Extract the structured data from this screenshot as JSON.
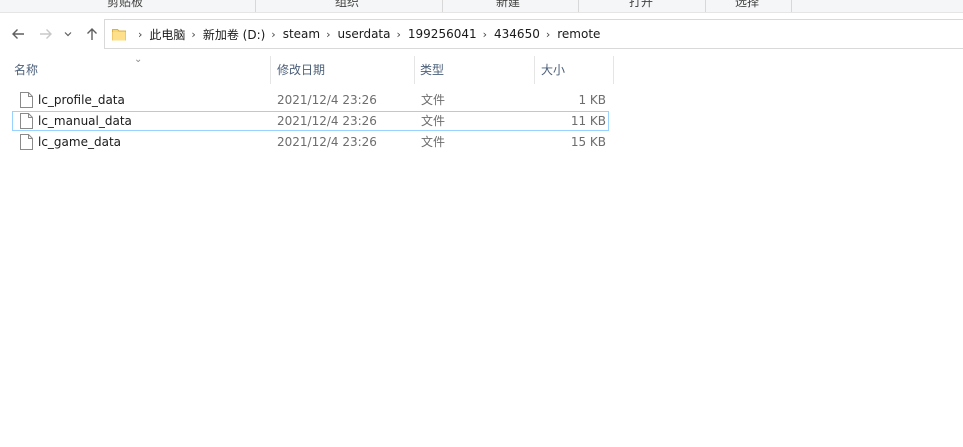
{
  "ribbon": {
    "groups": [
      "剪贴板",
      "组织",
      "新建",
      "打开",
      "选择"
    ]
  },
  "address": {
    "crumbs": [
      "此电脑",
      "新加卷 (D:)",
      "steam",
      "userdata",
      "199256041",
      "434650",
      "remote"
    ]
  },
  "columns": {
    "name": "名称",
    "date": "修改日期",
    "type": "类型",
    "size": "大小"
  },
  "files": [
    {
      "name": "lc_profile_data",
      "date": "2021/12/4 23:26",
      "type": "文件",
      "size": "1 KB"
    },
    {
      "name": "lc_manual_data",
      "date": "2021/12/4 23:26",
      "type": "文件",
      "size": "11 KB"
    },
    {
      "name": "lc_game_data",
      "date": "2021/12/4 23:26",
      "type": "文件",
      "size": "15 KB"
    }
  ],
  "icons": {
    "back": "back-arrow-icon",
    "forward": "forward-arrow-icon",
    "recent": "chevron-down-icon",
    "up": "up-arrow-icon",
    "folder": "folder-icon",
    "file": "file-icon"
  }
}
